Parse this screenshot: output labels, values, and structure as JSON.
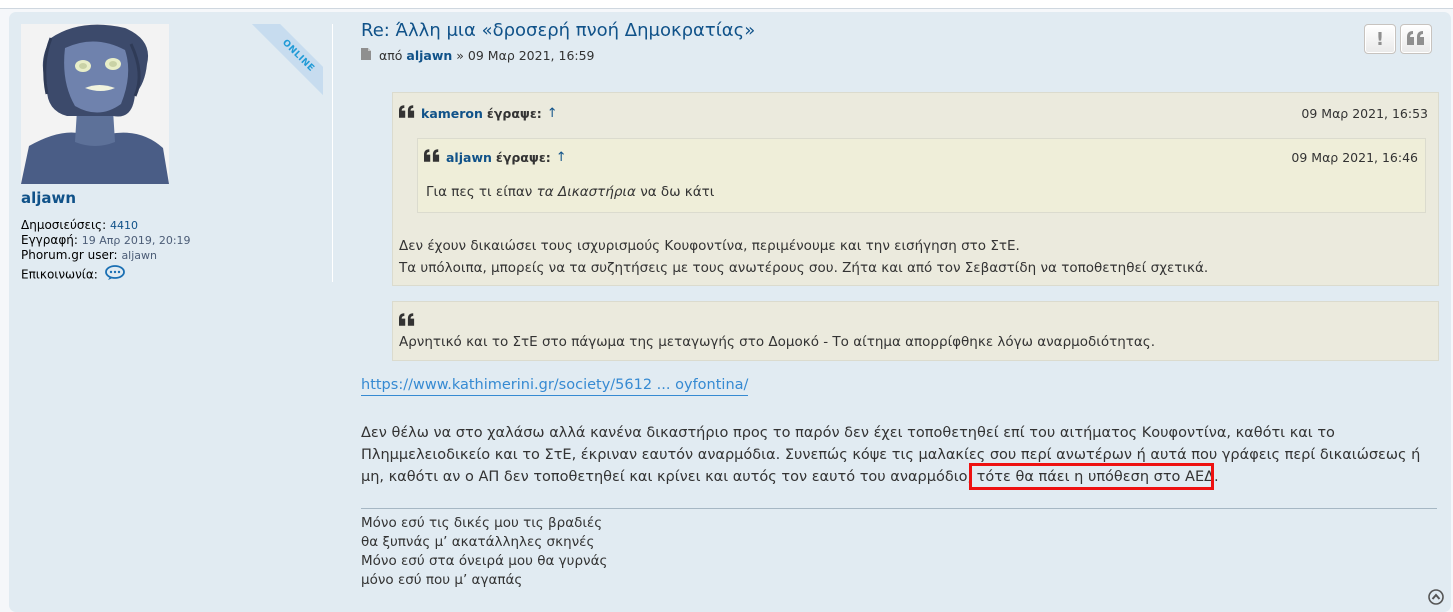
{
  "profile": {
    "username": "aljawn",
    "online_badge": "ONLINE",
    "posts_label": "Δημοσιεύσεις:",
    "posts_value": "4410",
    "joined_label": "Εγγραφή:",
    "joined_value": "19 Απρ 2019, 20:19",
    "phorum_label": "Phorum.gr user:",
    "phorum_value": "aljawn",
    "contact_label": "Επικοινωνία:"
  },
  "post": {
    "title": "Re: Άλλη μια «δροσερή πνοή Δημοκρατίας»",
    "by_label": "από",
    "author": "aljawn",
    "separator": "»",
    "date": "09 Μαρ 2021, 16:59",
    "report_label": "!",
    "quote_label": "❝"
  },
  "quote_outer": {
    "author": "kameron",
    "wrote": "έγραψε:",
    "arrow": "↑",
    "date": "09 Μαρ 2021, 16:53",
    "line1": "Δεν έχουν δικαιώσει τους ισχυρισμούς Κουφοντίνα, περιμένουμε και την εισήγηση στο ΣτΕ.",
    "line2": "Τα υπόλοιπα, μπορείς να τα συζητήσεις με τους ανωτέρους σου. Ζήτα και από τον Σεβαστίδη να τοποθετηθεί σχετικά."
  },
  "quote_inner": {
    "author": "aljawn",
    "wrote": "έγραψε:",
    "arrow": "↑",
    "date": "09 Μαρ 2021, 16:46",
    "text_before": "Για πες τι είπαν ",
    "text_italic": "τα Δικαστήρια",
    "text_after": " να δω κάτι"
  },
  "quote_anonymous": {
    "text": "Αρνητικό και το ΣτΕ στο πάγωμα της μεταγωγής στο Δομοκό - Το αίτημα απορρίφθηκε λόγω αναρμοδιότητας."
  },
  "link": {
    "text": "https://www.kathimerini.gr/society/5612 ... oyfontina/"
  },
  "body": {
    "line1": "Δεν θέλω να στο χαλάσω αλλά κανένα δικαστήριο προς το παρόν δεν έχει τοποθετηθεί επί του αιτήματος Κουφοντίνα, καθότι και το",
    "line2": "Πλημμελειοδικείο και το ΣτΕ, έκριναν εαυτόν αναρμόδια. Συνεπώς κόψε τις μαλακίες σου περί ανωτέρων ή αυτά που γράφεις περί δικαιώσεως ή",
    "line3": "μη, καθότι αν ο ΑΠ δεν τοποθετηθεί και κρίνει και αυτός τον εαυτό του αναρμόδιο, τότε θα πάει η υπόθεση στο ΑΕΔ."
  },
  "signature": {
    "line1": "Μόνο εσύ τις δικές μου τις βραδιές",
    "line2": "θα ξυπνάς μ’ ακατάλληλες σκηνές",
    "line3": "Μόνο εσύ στα όνειρά μου θα γυρνάς",
    "line4": "μόνο εσύ που μ’ αγαπάς"
  },
  "colors": {
    "post_bg": "#e1ebf2",
    "link_blue": "#105289",
    "quote_bg": "#ebeadd",
    "highlight": "#ee1111"
  }
}
